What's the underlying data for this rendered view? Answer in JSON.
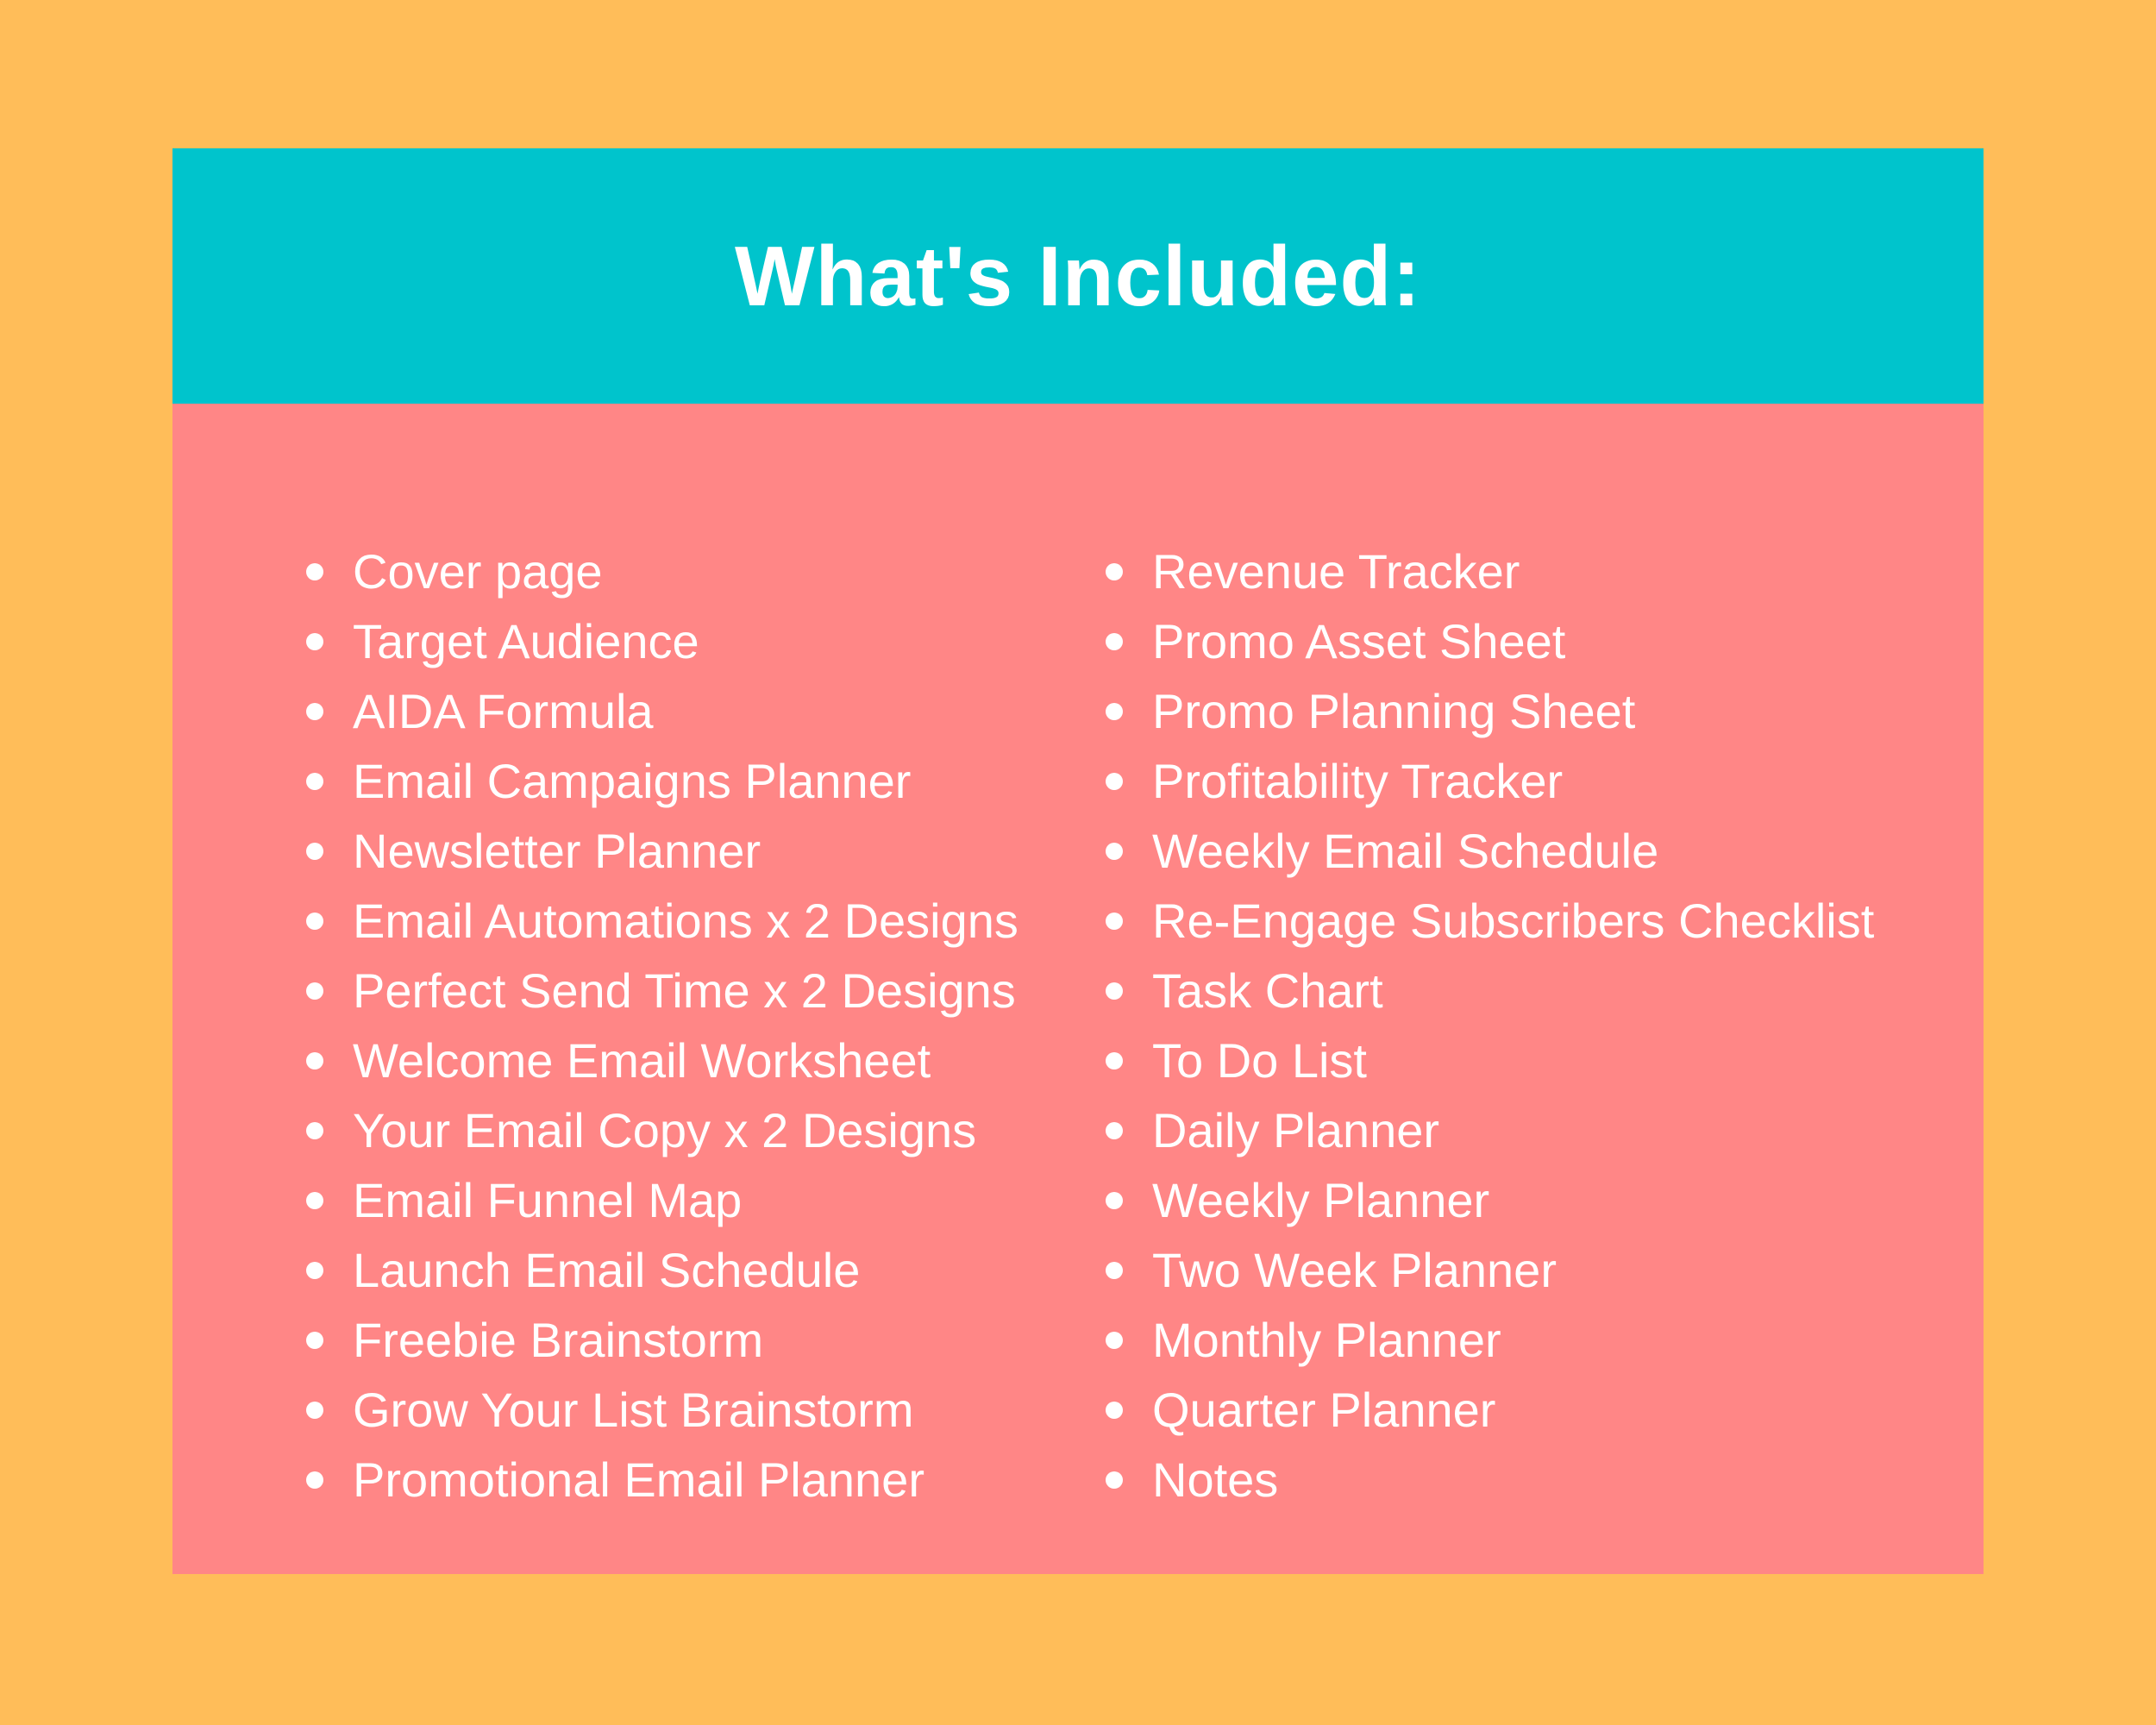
{
  "colors": {
    "background": "#FFBD59",
    "header": "#00C4CC",
    "panel": "#FF8686",
    "text": "#FFFFFF"
  },
  "header": {
    "title": "What's Included:"
  },
  "left_items": [
    "Cover page",
    "Target Audience",
    "AIDA Formula",
    "Email Campaigns Planner",
    "Newsletter Planner",
    "Email Automations x 2 Designs",
    "Perfect Send Time x 2 Designs",
    "Welcome Email Worksheet",
    "Your Email Copy x 2 Designs",
    "Email Funnel Map",
    "Launch Email Schedule",
    "Freebie Brainstorm",
    "Grow Your List Brainstorm",
    "Promotional Email Planner"
  ],
  "right_items": [
    "Revenue Tracker",
    "Promo Asset Sheet",
    "Promo Planning Sheet",
    "Profitability Tracker",
    "Weekly Email Schedule",
    "Re-Engage Subscribers Checklist",
    "Task Chart",
    "To Do List",
    "Daily Planner",
    "Weekly Planner",
    "Two Week Planner",
    "Monthly Planner",
    "Quarter Planner",
    "Notes"
  ]
}
